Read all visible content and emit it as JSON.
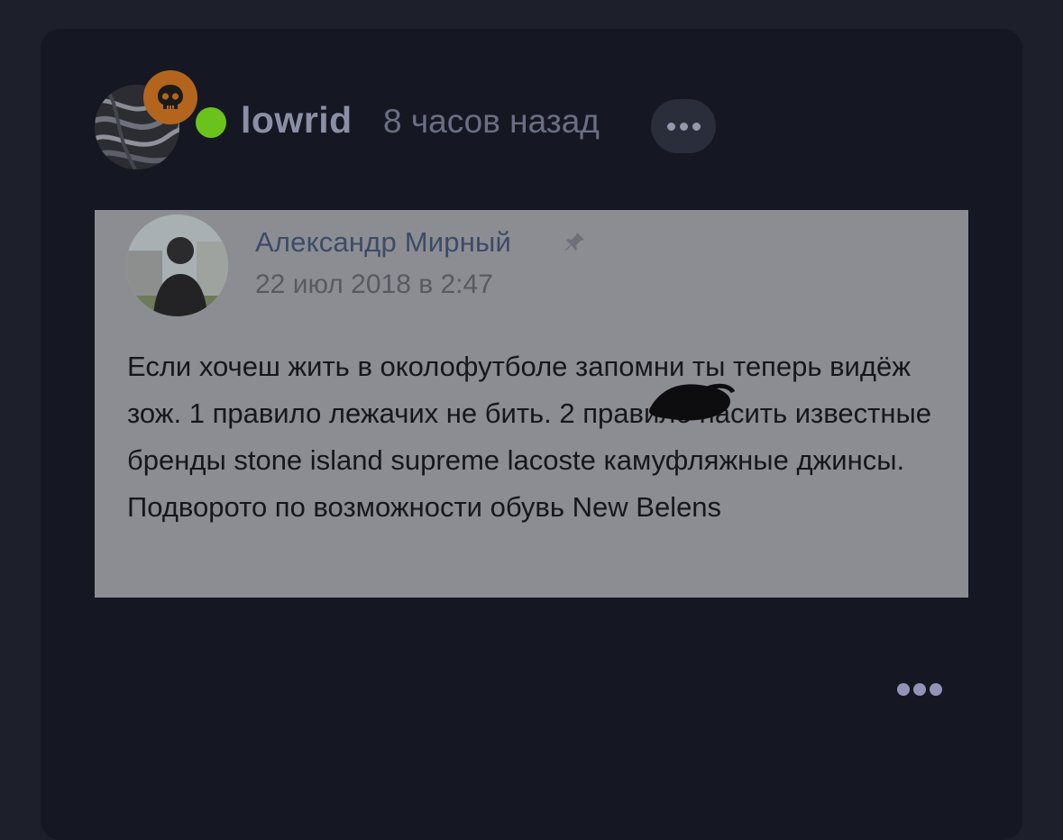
{
  "post": {
    "username": "lowrid",
    "timestamp": "8 часов назад",
    "avatar_icon": "abstract-swirl-avatar",
    "badge_icon": "skull-icon",
    "online_status": "online",
    "online_color": "#6cc21c",
    "badge_color": "#b3651e"
  },
  "embedded_post": {
    "author": "Александр Мирный",
    "date": "22 июл 2018 в 2:47",
    "pin_icon": "pin-icon",
    "text": "Если хочеш жить в околофутболе запомни ты теперь видёж зож. 1 правило  лежачих не бить. 2 правило насить известные бренды stone island  supreme lacoste камуфляжные джинсы. Подворото по возможности обувь New Belens"
  },
  "colors": {
    "background": "#1d1f2b",
    "card": "#151822",
    "username": "#8b8fa6",
    "accent_dots": "#9193b8"
  }
}
